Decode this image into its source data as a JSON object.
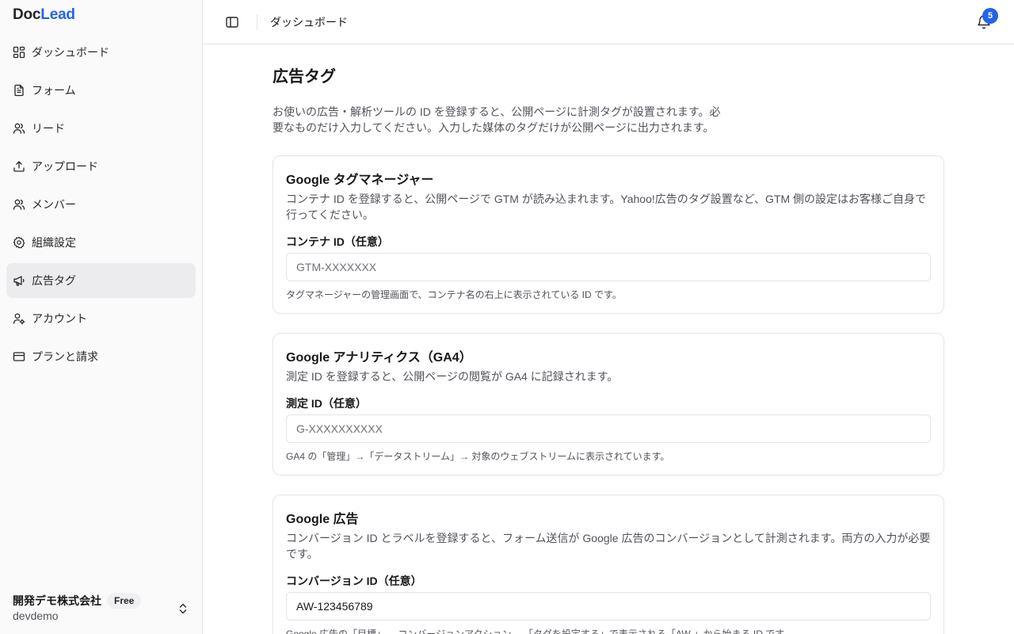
{
  "brand": {
    "part1": "Doc",
    "part2": "Lead",
    "accent_color": "#2563eb"
  },
  "sidebar": {
    "items": [
      {
        "label": "ダッシュボード",
        "icon": "layout-dashboard-icon"
      },
      {
        "label": "フォーム",
        "icon": "file-text-icon"
      },
      {
        "label": "リード",
        "icon": "users-icon"
      },
      {
        "label": "アップロード",
        "icon": "upload-icon"
      },
      {
        "label": "メンバー",
        "icon": "users-icon"
      },
      {
        "label": "組織設定",
        "icon": "gear-icon"
      },
      {
        "label": "広告タグ",
        "icon": "megaphone-icon",
        "active": true
      },
      {
        "label": "アカウント",
        "icon": "user-cog-icon"
      },
      {
        "label": "プランと請求",
        "icon": "credit-card-icon"
      }
    ],
    "org": {
      "name": "開発デモ株式会社",
      "plan": "Free",
      "slug": "devdemo"
    }
  },
  "header": {
    "title": "ダッシュボード",
    "notifications_count": "5"
  },
  "main": {
    "title": "広告タグ",
    "description": "お使いの広告・解析ツールの ID を登録すると、公開ページに計測タグが設置されます。必要なものだけ入力してください。入力した媒体のタグだけが公開ページに出力されます。",
    "cards": [
      {
        "title": "Google タグマネージャー",
        "description": "コンテナ ID を登録すると、公開ページで GTM が読み込まれます。Yahoo!広告のタグ設置など、GTM 側の設定はお客様ご自身で行ってください。",
        "field_label": "コンテナ ID（任意）",
        "placeholder": "GTM-XXXXXXX",
        "value": "",
        "hint": "タグマネージャーの管理画面で、コンテナ名の右上に表示されている ID です。"
      },
      {
        "title": "Google アナリティクス（GA4）",
        "description": "測定 ID を登録すると、公開ページの閲覧が GA4 に記録されます。",
        "field_label": "測定 ID（任意）",
        "placeholder": "G-XXXXXXXXXX",
        "value": "",
        "hint": "GA4 の「管理」→「データストリーム」→ 対象のウェブストリームに表示されています。"
      },
      {
        "title": "Google 広告",
        "description": "コンバージョン ID とラベルを登録すると、フォーム送信が Google 広告のコンバージョンとして計測されます。両方の入力が必要です。",
        "field_label": "コンバージョン ID（任意）",
        "placeholder": "",
        "value": "AW-123456789",
        "hint": "Google 広告の「目標」→ コンバージョンアクション →「タグを設定する」で表示される「AW-」から始まる ID です。"
      }
    ]
  }
}
